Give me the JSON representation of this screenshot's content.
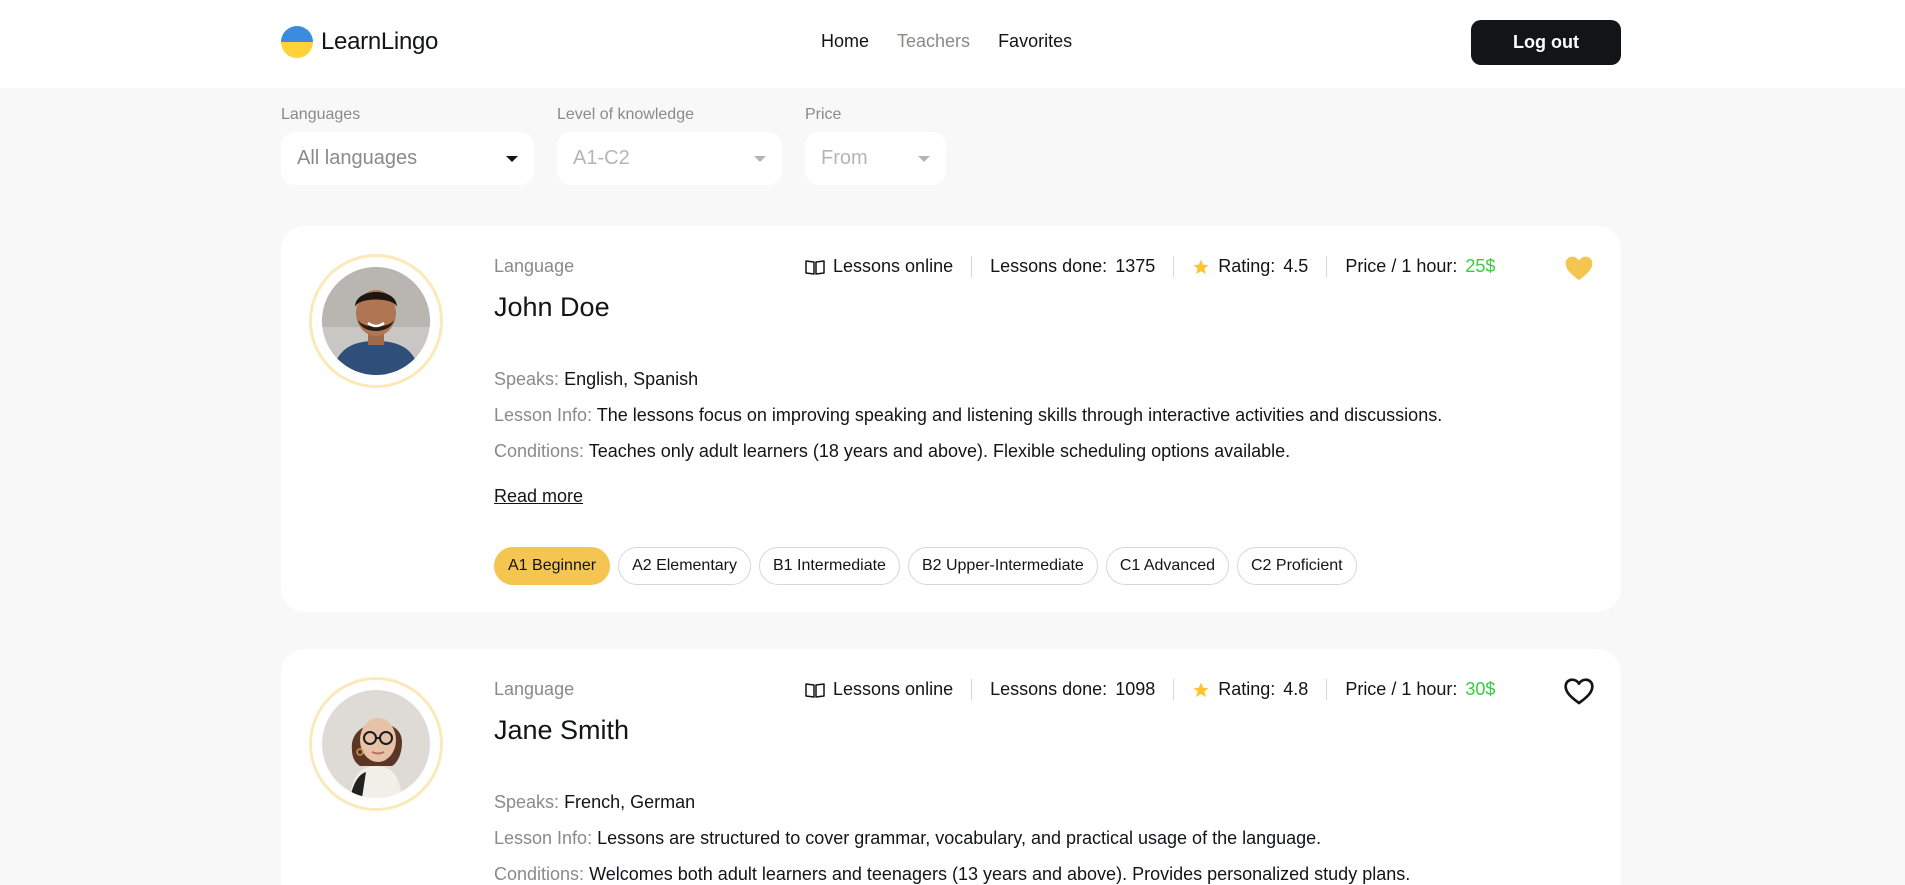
{
  "brand": {
    "name": "LearnLingo"
  },
  "nav": {
    "home": "Home",
    "teachers": "Teachers",
    "favorites": "Favorites"
  },
  "auth": {
    "logout": "Log out"
  },
  "filters": {
    "languages": {
      "label": "Languages",
      "value": "All languages"
    },
    "level": {
      "label": "Level of knowledge",
      "value": "A1-C2"
    },
    "price": {
      "label": "Price",
      "value": "From"
    }
  },
  "common": {
    "language_label": "Language",
    "lessons_online": "Lessons online",
    "speaks_label": "Speaks:",
    "info_label": "Lesson Info:",
    "conditions_label": "Conditions:",
    "read_more": "Read more",
    "lessons_done_prefix": "Lessons done:",
    "rating_prefix": "Rating:",
    "price_label": "Price / 1 hour:"
  },
  "teachers": [
    {
      "name": "John Doe",
      "lessons_done": "1375",
      "rating": "4.5",
      "price": "25$",
      "favorite": true,
      "speaks": "English, Spanish",
      "lesson_info": "The lessons focus on improving speaking and listening skills through interactive activities and discussions.",
      "conditions": "Teaches only adult learners (18 years and above). Flexible scheduling options available.",
      "levels": [
        "A1 Beginner",
        "A2 Elementary",
        "B1 Intermediate",
        "B2 Upper-Intermediate",
        "C1 Advanced",
        "C2 Proficient"
      ],
      "selected_level": "A1 Beginner"
    },
    {
      "name": "Jane Smith",
      "lessons_done": "1098",
      "rating": "4.8",
      "price": "30$",
      "favorite": false,
      "speaks": "French, German",
      "lesson_info": "Lessons are structured to cover grammar, vocabulary, and practical usage of the language.",
      "conditions": "Welcomes both adult learners and teenagers (13 years and above). Provides personalized study plans."
    }
  ],
  "colors": {
    "accent": "#f4c550",
    "price": "#38cd3e",
    "dark": "#121417",
    "muted": "#8a8a89"
  }
}
